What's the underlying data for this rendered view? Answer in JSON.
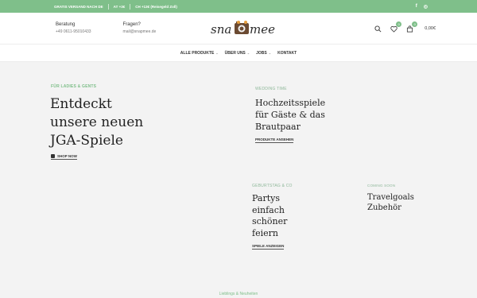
{
  "topbar": {
    "msg1": "GRATIS VERSAND NACH DE",
    "msg2": "AT +3€",
    "msg3": "CH +13€ (Reisegeld Zoll)",
    "social": [
      "f",
      "◎"
    ]
  },
  "header": {
    "contact1_title": "Beratung",
    "contact1_value": "+49 0611-95010433",
    "contact2_title": "Fragen?",
    "contact2_value": "mail@snapmee.de",
    "logo_text_left": "sna",
    "logo_text_right": "mee",
    "wishlist_count": "0",
    "cart_count": "0",
    "cart_total": "0,00€"
  },
  "nav": {
    "items": [
      "ALLE PRODUKTE",
      "ÜBER UNS",
      "JOBS",
      "KONTAKT"
    ]
  },
  "hero": {
    "kicker": "FÜR LADIES & GENTS",
    "line1": "Entdeckt",
    "line2": "unsere neuen",
    "line3": "JGA-Spiele",
    "cta": "SHOP NOW"
  },
  "wedding": {
    "kicker": "WEDDING TIME",
    "line1": "Hochzeitsspiele",
    "line2": "für Gäste & das",
    "line3": "Brautpaar",
    "cta": "PRODUKTE ANSEHEN"
  },
  "birthday": {
    "kicker": "GEBURTSTAG & CO",
    "line1": "Partys",
    "line2": "einfach",
    "line3": "schöner",
    "line4": "feiern",
    "cta": "SPIELE ANZEIGEN"
  },
  "travel": {
    "kicker": "COMING SOON",
    "line1": "Travelgoals",
    "line2": "Zubehör"
  },
  "footer": {
    "kicker": "Lieblings & Neuheiten"
  },
  "colors": {
    "accent": "#7fbf8a",
    "background": "#f3f3f3"
  }
}
